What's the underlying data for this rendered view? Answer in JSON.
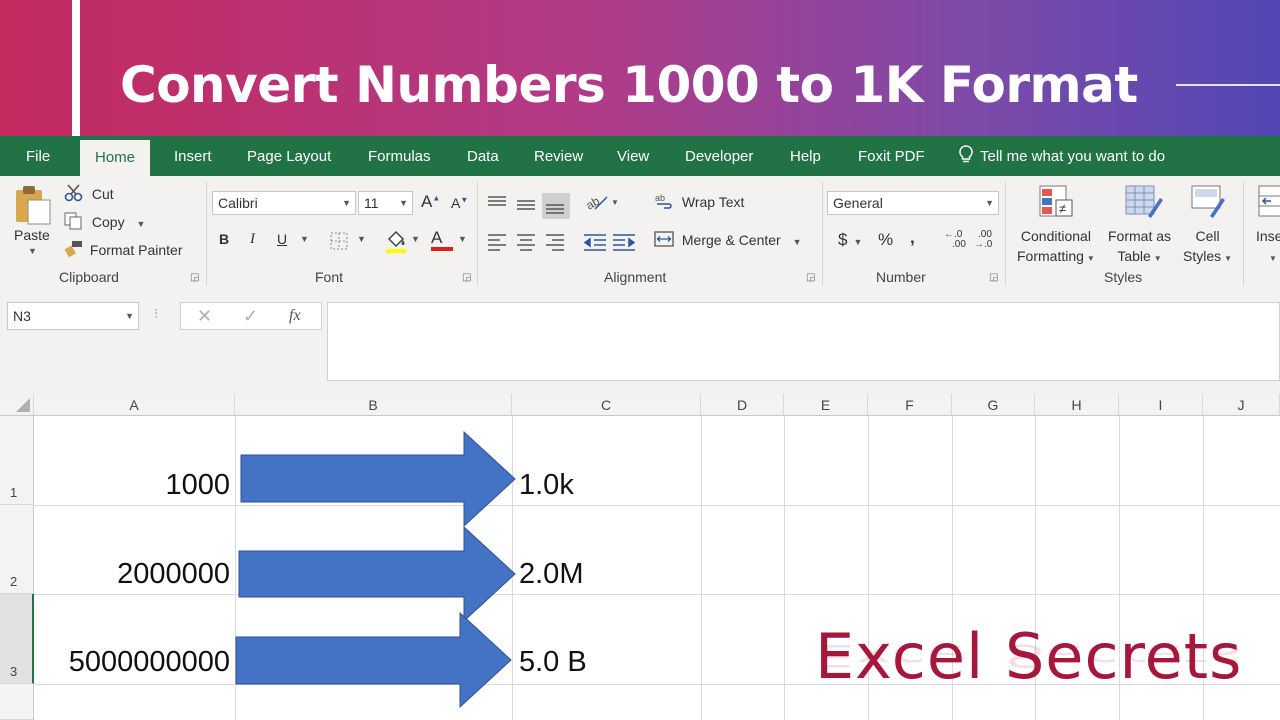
{
  "banner": {
    "title": "Convert Numbers 1000 to 1K Format"
  },
  "tabs": [
    "File",
    "Home",
    "Insert",
    "Page Layout",
    "Formulas",
    "Data",
    "Review",
    "View",
    "Developer",
    "Help",
    "Foxit PDF"
  ],
  "tell_me": "Tell me what you want to do",
  "ribbon": {
    "clipboard": {
      "paste": "Paste",
      "cut": "Cut",
      "copy": "Copy",
      "format_painter": "Format Painter",
      "label": "Clipboard"
    },
    "font": {
      "name": "Calibri",
      "size": "11",
      "bold": "B",
      "italic": "I",
      "underline": "U",
      "font_color": "A",
      "grow": "A",
      "shrink": "A",
      "label": "Font"
    },
    "alignment": {
      "wrap_text": "Wrap Text",
      "merge_center": "Merge & Center",
      "label": "Alignment"
    },
    "number": {
      "format": "General",
      "currency": "$",
      "percent": "%",
      "comma": ",",
      "inc_dec": ".00",
      "dec_dec": ".0",
      "label": "Number"
    },
    "styles": {
      "conditional_1": "Conditional",
      "conditional_2": "Formatting",
      "format_table_1": "Format as",
      "format_table_2": "Table",
      "cell_styles_1": "Cell",
      "cell_styles_2": "Styles",
      "insert": "Inse",
      "label": "Styles"
    }
  },
  "formula_bar": {
    "name_box": "N3",
    "fx": "fx",
    "value": ""
  },
  "columns": [
    "A",
    "B",
    "C",
    "D",
    "E",
    "F",
    "G",
    "H",
    "I",
    "J"
  ],
  "rows": [
    {
      "num": "1",
      "a": "1000",
      "c": "1.0k"
    },
    {
      "num": "2",
      "a": "2000000",
      "c": "2.0M"
    },
    {
      "num": "3",
      "a": "5000000000",
      "c": "5.0 B"
    }
  ],
  "brand": "Excel Secrets",
  "colors": {
    "excel_green": "#217346",
    "arrow_blue": "#4472c4",
    "brand_red": "#a6173c",
    "banner_start": "#c32a5f",
    "banner_end": "#5247b4"
  }
}
